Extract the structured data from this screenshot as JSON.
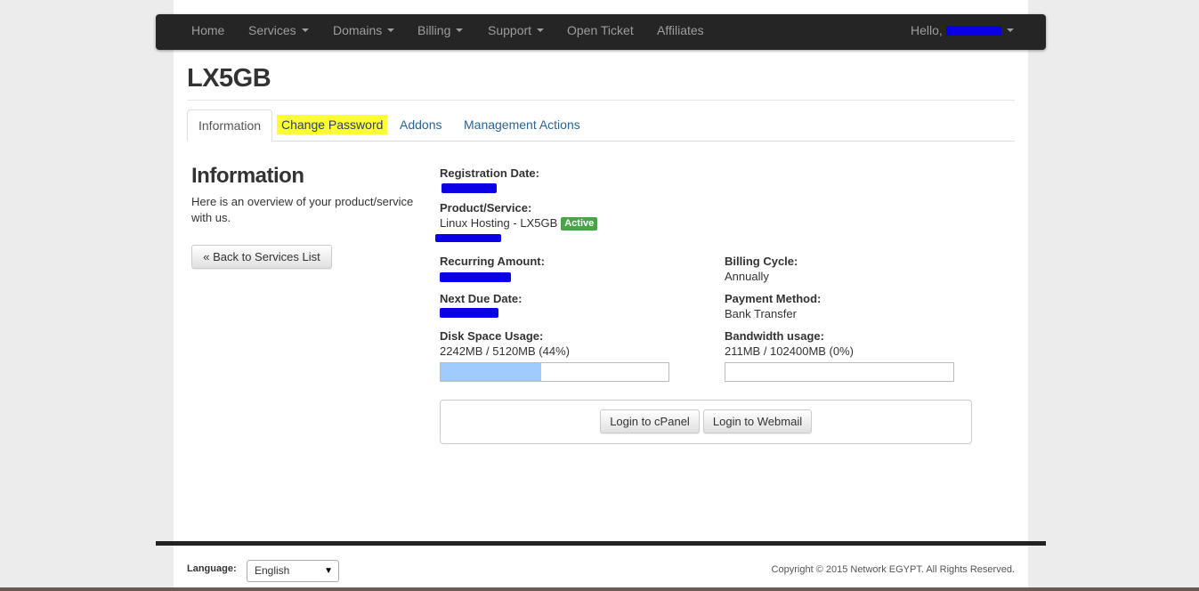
{
  "nav": {
    "home": "Home",
    "services": "Services",
    "domains": "Domains",
    "billing": "Billing",
    "support": "Support",
    "open_ticket": "Open Ticket",
    "affiliates": "Affiliates",
    "hello": "Hello,"
  },
  "page_title": "LX5GB",
  "tabs": {
    "information": "Information",
    "change_password": "Change Password",
    "addons": "Addons",
    "management_actions": "Management Actions"
  },
  "sidebar": {
    "heading": "Information",
    "description": "Here is an overview of your product/service with us.",
    "back_button": "« Back to Services List"
  },
  "details": {
    "registration_date_label": "Registration Date:",
    "product_service_label": "Product/Service:",
    "product_service_value": "Linux Hosting - LX5GB",
    "status_badge": "Active",
    "recurring_amount_label": "Recurring Amount:",
    "billing_cycle_label": "Billing Cycle:",
    "billing_cycle_value": "Annually",
    "next_due_date_label": "Next Due Date:",
    "payment_method_label": "Payment Method:",
    "payment_method_value": "Bank Transfer",
    "disk_space_label": "Disk Space Usage:",
    "disk_space_value": "2242MB / 5120MB (44%)",
    "disk_space_percent": 44,
    "bandwidth_label": "Bandwidth usage:",
    "bandwidth_value": "211MB / 102400MB (0%)",
    "bandwidth_percent": 0
  },
  "actions": {
    "cpanel": "Login to cPanel",
    "webmail": "Login to Webmail"
  },
  "footer": {
    "language_label": "Language:",
    "language_value": "English",
    "copyright": "Copyright © 2015 Network EGYPT. All Rights Reserved."
  },
  "colors": {
    "navbar": "#252525",
    "link": "#2a6496",
    "highlight": "#ffff33",
    "active_badge": "#47a447",
    "progress_fill": "#9fccfa",
    "redaction": "#0a00e6"
  },
  "icons": {
    "dropdown": "caret-down-icon",
    "select_arrow": "triangle-down-icon"
  }
}
